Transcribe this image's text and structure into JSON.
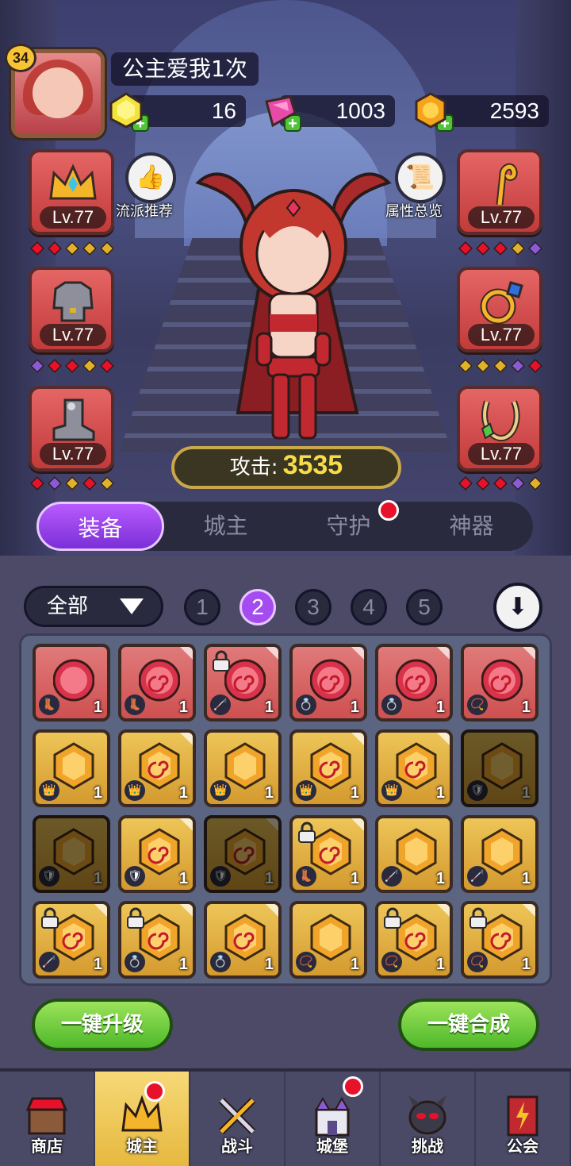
{
  "player": {
    "level": "34",
    "name": "公主爱我1次"
  },
  "resources": [
    {
      "icon": "gold-gem-icon",
      "value": "16"
    },
    {
      "icon": "pink-diamond-icon",
      "value": "1003"
    },
    {
      "icon": "gold-coin-icon",
      "value": "2593"
    }
  ],
  "side_buttons": {
    "left_label": "流派推荐",
    "right_label": "属性总览"
  },
  "equipment": {
    "left": [
      {
        "icon": "crown-icon",
        "level": "Lv.77"
      },
      {
        "icon": "armor-icon",
        "level": "Lv.77"
      },
      {
        "icon": "boot-icon",
        "level": "Lv.77"
      }
    ],
    "right": [
      {
        "icon": "staff-icon",
        "level": "Lv.77"
      },
      {
        "icon": "ring-icon",
        "level": "Lv.77"
      },
      {
        "icon": "necklace-icon",
        "level": "Lv.77"
      }
    ]
  },
  "attack": {
    "label": "攻击:",
    "value": "3535"
  },
  "tabs": [
    "装备",
    "城主",
    "守护",
    "神器"
  ],
  "filter": {
    "label": "全部"
  },
  "pages": [
    "1",
    "2",
    "3",
    "4",
    "5"
  ],
  "actions": {
    "upgrade": "一键升级",
    "combine": "一键合成"
  },
  "nav": [
    "商店",
    "城主",
    "战斗",
    "城堡",
    "挑战",
    "公会"
  ],
  "colors": {
    "accent": "#a54cf0",
    "ruby": "#d85a5a",
    "amber": "#e0a83a",
    "green": "#6fcc36",
    "alert": "#e8112a"
  },
  "inventory": [
    {
      "gem": "ruby",
      "swirl": false,
      "type": "boot-icon",
      "count": "1",
      "lock": false
    },
    {
      "gem": "ruby",
      "swirl": true,
      "type": "boot-icon",
      "count": "1",
      "lock": false
    },
    {
      "gem": "ruby",
      "swirl": true,
      "type": "staff-icon",
      "count": "1",
      "lock": true
    },
    {
      "gem": "ruby",
      "swirl": true,
      "type": "ring-icon",
      "count": "1",
      "lock": false
    },
    {
      "gem": "ruby",
      "swirl": true,
      "type": "ring-icon",
      "count": "1",
      "lock": false
    },
    {
      "gem": "ruby",
      "swirl": true,
      "type": "necklace-icon",
      "count": "1",
      "lock": false
    },
    {
      "gem": "amber",
      "swirl": false,
      "type": "crown-icon",
      "count": "1",
      "lock": false
    },
    {
      "gem": "amber",
      "swirl": true,
      "type": "crown-icon",
      "count": "1",
      "lock": false
    },
    {
      "gem": "amber",
      "swirl": false,
      "type": "crown-icon",
      "count": "1",
      "lock": false
    },
    {
      "gem": "amber",
      "swirl": true,
      "type": "crown-icon",
      "count": "1",
      "lock": false
    },
    {
      "gem": "amber",
      "swirl": true,
      "type": "crown-icon",
      "count": "1",
      "lock": false
    },
    {
      "gem": "amber",
      "swirl": false,
      "type": "armor-icon",
      "count": "1",
      "lock": false,
      "dim": true
    },
    {
      "gem": "amber",
      "swirl": false,
      "type": "armor-icon",
      "count": "1",
      "lock": false,
      "dim": true
    },
    {
      "gem": "amber",
      "swirl": true,
      "type": "armor-icon",
      "count": "1",
      "lock": false
    },
    {
      "gem": "amber",
      "swirl": true,
      "type": "armor-icon",
      "count": "1",
      "lock": false,
      "dim": true
    },
    {
      "gem": "amber",
      "swirl": true,
      "type": "boot-icon",
      "count": "1",
      "lock": true
    },
    {
      "gem": "amber",
      "swirl": false,
      "type": "staff-icon",
      "count": "1",
      "lock": false
    },
    {
      "gem": "amber",
      "swirl": false,
      "type": "staff-icon",
      "count": "1",
      "lock": false
    },
    {
      "gem": "amber",
      "swirl": true,
      "type": "staff-icon",
      "count": "1",
      "lock": true
    },
    {
      "gem": "amber",
      "swirl": true,
      "type": "ring-icon",
      "count": "1",
      "lock": true
    },
    {
      "gem": "amber",
      "swirl": true,
      "type": "ring-icon",
      "count": "1",
      "lock": false
    },
    {
      "gem": "amber",
      "swirl": false,
      "type": "necklace-icon",
      "count": "1",
      "lock": false
    },
    {
      "gem": "amber",
      "swirl": true,
      "type": "necklace-icon",
      "count": "1",
      "lock": true
    },
    {
      "gem": "amber",
      "swirl": true,
      "type": "necklace-icon",
      "count": "1",
      "lock": true
    }
  ]
}
